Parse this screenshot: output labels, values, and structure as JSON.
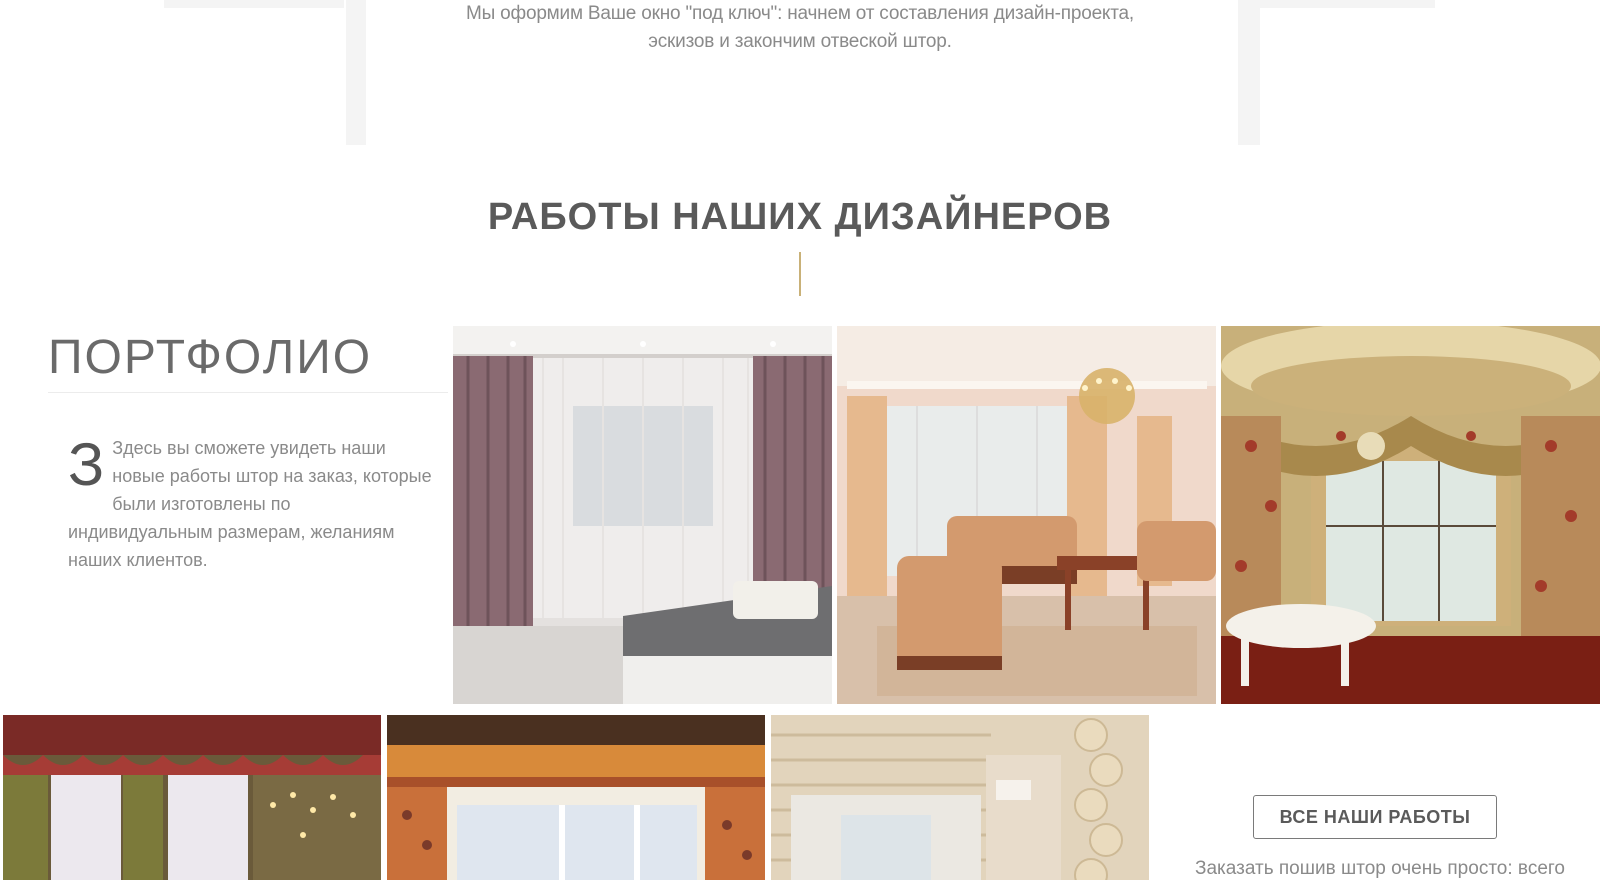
{
  "intro": {
    "line1": "Мы оформим Ваше окно \"под ключ\": начнем от составления дизайн-проекта,",
    "line2": "эскизов и закончим отвеской штор."
  },
  "section": {
    "title": "РАБОТЫ НАШИХ ДИЗАЙНЕРОВ"
  },
  "portfolio": {
    "heading": "ПОРТФОЛИО",
    "dropcap": "З",
    "description": "Здесь вы сможете увидеть наши новые работы штор на заказ, которые были изготовлены по индивидуальным размерам, желаниям наших клиентов."
  },
  "gallery": {
    "tiles": [
      {
        "subject": "modern living room with mauve curtains and white tulle"
      },
      {
        "subject": "classic living room with peach curtains and chandelier"
      },
      {
        "subject": "dining room with floral swag curtains and lambrequin"
      },
      {
        "subject": "burgundy and green austrian curtains with chandelier"
      },
      {
        "subject": "orange floral curtains with valance"
      },
      {
        "subject": "log house interior with sheer curtains"
      }
    ]
  },
  "cta": {
    "all_works_label": "ВСЕ НАШИ РАБОТЫ",
    "order_text": "Заказать пошив штор очень просто: всего"
  },
  "colors": {
    "accent_divider": "#c9b178",
    "text_gray": "#8a8a8a",
    "heading_gray": "#5a5a5a"
  }
}
